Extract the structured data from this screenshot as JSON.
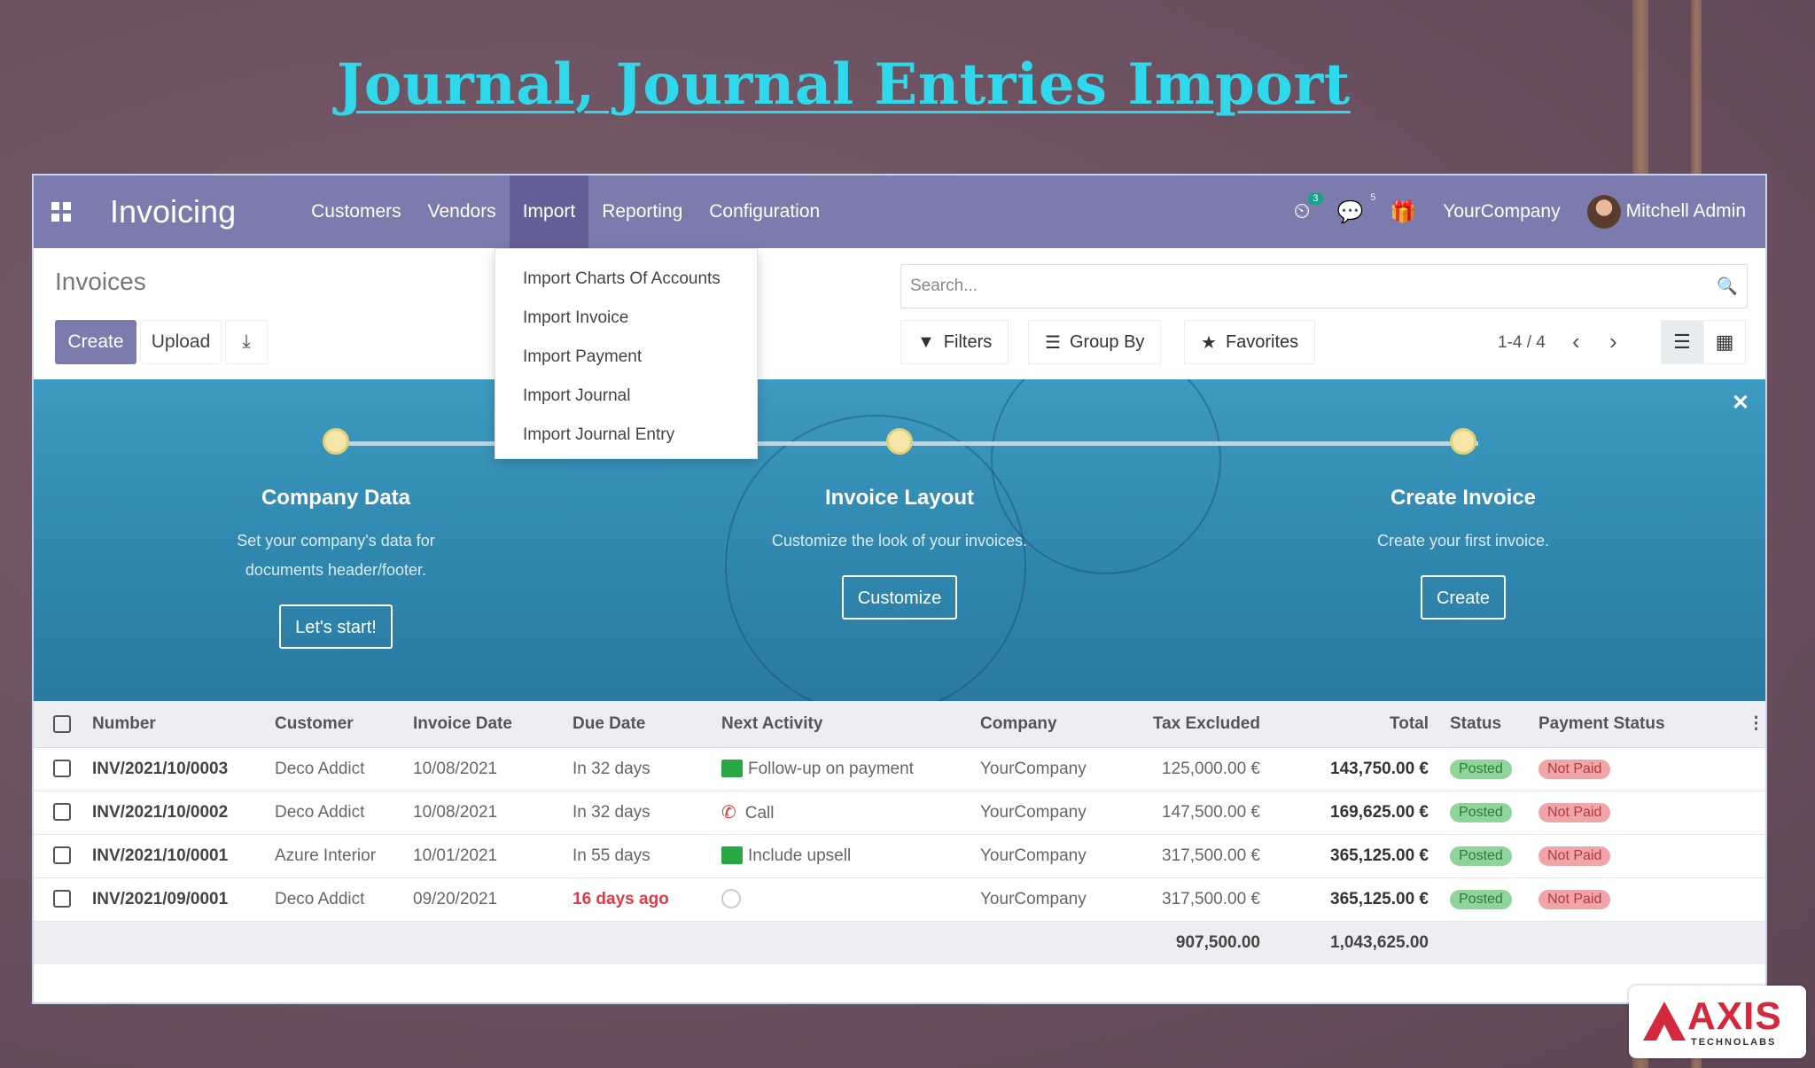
{
  "slide": {
    "title": "Journal, Journal Entries Import"
  },
  "navbar": {
    "brand": "Invoicing",
    "menu": [
      "Customers",
      "Vendors",
      "Import",
      "Reporting",
      "Configuration"
    ],
    "activity_badge": "3",
    "message_count": "5",
    "company": "YourCompany",
    "user": "Mitchell Admin"
  },
  "import_menu": [
    "Import Charts Of Accounts",
    "Import Invoice",
    "Import Payment",
    "Import Journal",
    "Import Journal Entry"
  ],
  "control": {
    "breadcrumb": "Invoices",
    "create": "Create",
    "upload": "Upload",
    "search_placeholder": "Search...",
    "filters": "Filters",
    "group_by": "Group By",
    "favorites": "Favorites",
    "pager": "1-4 / 4"
  },
  "banner": {
    "steps": [
      {
        "title": "Company Data",
        "desc": "Set your company's data for documents header/footer.",
        "button": "Let's start!"
      },
      {
        "title": "Invoice Layout",
        "desc": "Customize the look of your invoices.",
        "button": "Customize"
      },
      {
        "title": "Create Invoice",
        "desc": "Create your first invoice.",
        "button": "Create"
      }
    ]
  },
  "table": {
    "columns": [
      "Number",
      "Customer",
      "Invoice Date",
      "Due Date",
      "Next Activity",
      "Company",
      "Tax Excluded",
      "Total",
      "Status",
      "Payment Status"
    ],
    "rows": [
      {
        "number": "INV/2021/10/0003",
        "customer": "Deco Addict",
        "date": "10/08/2021",
        "due": "In 32 days",
        "activity": "Follow-up on payment",
        "activity_icon": "checklist-icon",
        "company": "YourCompany",
        "tax_excl": "125,000.00 €",
        "total": "143,750.00 €",
        "status": "Posted",
        "payment": "Not Paid"
      },
      {
        "number": "INV/2021/10/0002",
        "customer": "Deco Addict",
        "date": "10/08/2021",
        "due": "In 32 days",
        "activity": "Call",
        "activity_icon": "phone-icon",
        "company": "YourCompany",
        "tax_excl": "147,500.00 €",
        "total": "169,625.00 €",
        "status": "Posted",
        "payment": "Not Paid"
      },
      {
        "number": "INV/2021/10/0001",
        "customer": "Azure Interior",
        "date": "10/01/2021",
        "due": "In 55 days",
        "activity": "Include upsell",
        "activity_icon": "checklist-icon",
        "company": "YourCompany",
        "tax_excl": "317,500.00 €",
        "total": "365,125.00 €",
        "status": "Posted",
        "payment": "Not Paid"
      },
      {
        "number": "INV/2021/09/0001",
        "customer": "Deco Addict",
        "date": "09/20/2021",
        "due": "16 days ago",
        "activity": "",
        "activity_icon": "empty-clock-icon",
        "company": "YourCompany",
        "tax_excl": "317,500.00 €",
        "total": "365,125.00 €",
        "status": "Posted",
        "payment": "Not Paid"
      }
    ],
    "totals": {
      "tax_excl": "907,500.00",
      "total": "1,043,625.00"
    }
  },
  "logo": {
    "word": "AXIS",
    "sub": "TECHNOLABS"
  }
}
